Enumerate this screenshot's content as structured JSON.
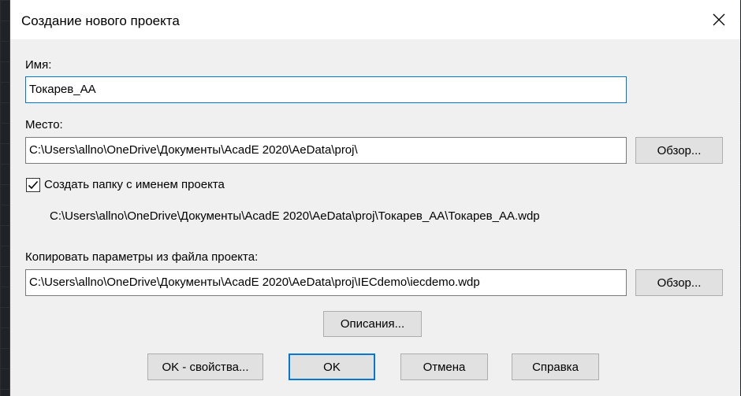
{
  "dialog": {
    "title": "Создание нового проекта",
    "close_icon": "close-icon"
  },
  "name": {
    "label": "Имя:",
    "value": "Токарев_АА"
  },
  "location": {
    "label": "Место:",
    "value": "C:\\Users\\allno\\OneDrive\\Документы\\AcadE 2020\\AeData\\proj\\",
    "browse_label": "Обзор..."
  },
  "create_folder": {
    "label": "Создать папку с именем проекта",
    "checked": true,
    "resulting_path": "C:\\Users\\allno\\OneDrive\\Документы\\AcadE 2020\\AeData\\proj\\Токарев_АА\\Токарев_АА.wdp"
  },
  "copy_settings": {
    "label": "Копировать параметры из файла проекта:",
    "value": "C:\\Users\\allno\\OneDrive\\Документы\\AcadE 2020\\AeData\\proj\\IECdemo\\iecdemo.wdp",
    "browse_label": "Обзор..."
  },
  "buttons": {
    "descriptions": "Описания...",
    "ok_properties": "OK - свойства...",
    "ok": "OK",
    "cancel": "Отмена",
    "help": "Справка"
  },
  "colors": {
    "accent": "#0078d7",
    "dialog_bg": "#f0f0f0",
    "button_bg": "#e1e1e1"
  }
}
